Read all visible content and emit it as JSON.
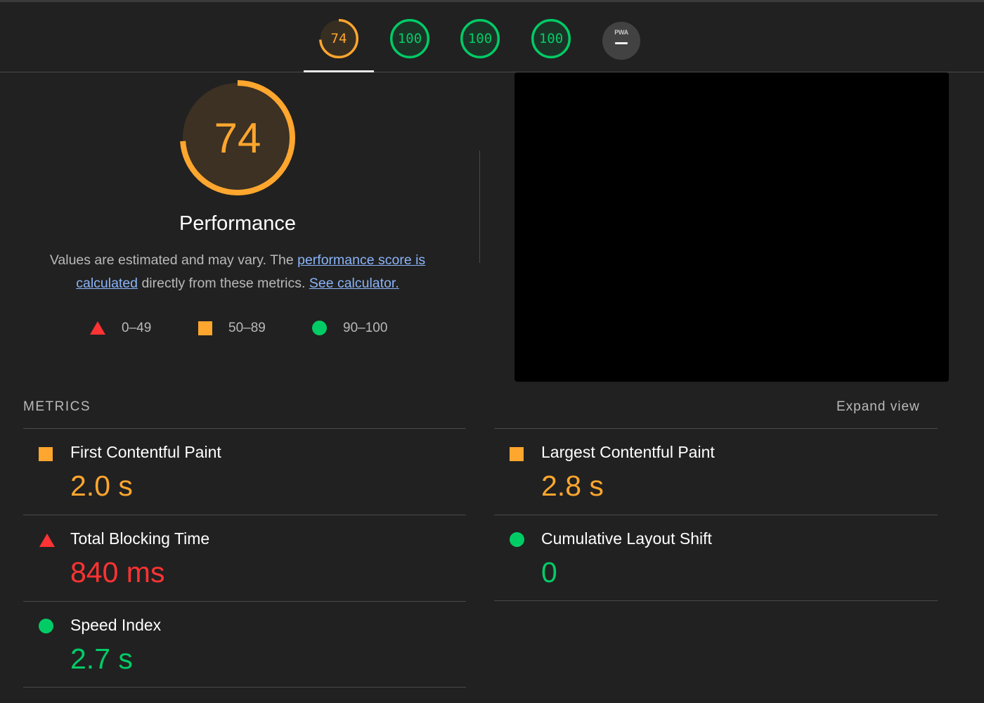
{
  "category_gauges": [
    {
      "id": "performance",
      "score": "74",
      "color": "#ffa62e",
      "fraction": 0.74,
      "selected": true
    },
    {
      "id": "accessibility",
      "score": "100",
      "color": "#0c6",
      "fraction": 1.0,
      "selected": false
    },
    {
      "id": "best-practices",
      "score": "100",
      "color": "#0c6",
      "fraction": 1.0,
      "selected": false
    },
    {
      "id": "seo",
      "score": "100",
      "color": "#0c6",
      "fraction": 1.0,
      "selected": false
    }
  ],
  "pwa_badge": {
    "label": "PWA",
    "icon": "dash-icon"
  },
  "performance": {
    "score": "74",
    "fraction": 0.74,
    "title": "Performance",
    "desc_prefix": "Values are estimated and may vary. The ",
    "link_score": "performance score is calculated",
    "desc_middle": " directly from these metrics. ",
    "link_calculator": "See calculator."
  },
  "legend": {
    "fail": {
      "range": "0–49",
      "icon": "triangle-icon",
      "color": "#ff3333"
    },
    "average": {
      "range": "50–89",
      "icon": "square-icon",
      "color": "#ffa62e"
    },
    "pass": {
      "range": "90–100",
      "icon": "circle-icon",
      "color": "#00cc66"
    }
  },
  "metrics": {
    "section_title": "METRICS",
    "expand_label": "Expand view",
    "items": [
      {
        "label": "First Contentful Paint",
        "value": "2.0 s",
        "rating": "average",
        "color": "#ffa62e"
      },
      {
        "label": "Largest Contentful Paint",
        "value": "2.8 s",
        "rating": "average",
        "color": "#ffa62e"
      },
      {
        "label": "Total Blocking Time",
        "value": "840 ms",
        "rating": "fail",
        "color": "#ff3333"
      },
      {
        "label": "Cumulative Layout Shift",
        "value": "0",
        "rating": "pass",
        "color": "#00cc66"
      },
      {
        "label": "Speed Index",
        "value": "2.7 s",
        "rating": "pass",
        "color": "#00cc66"
      }
    ]
  }
}
